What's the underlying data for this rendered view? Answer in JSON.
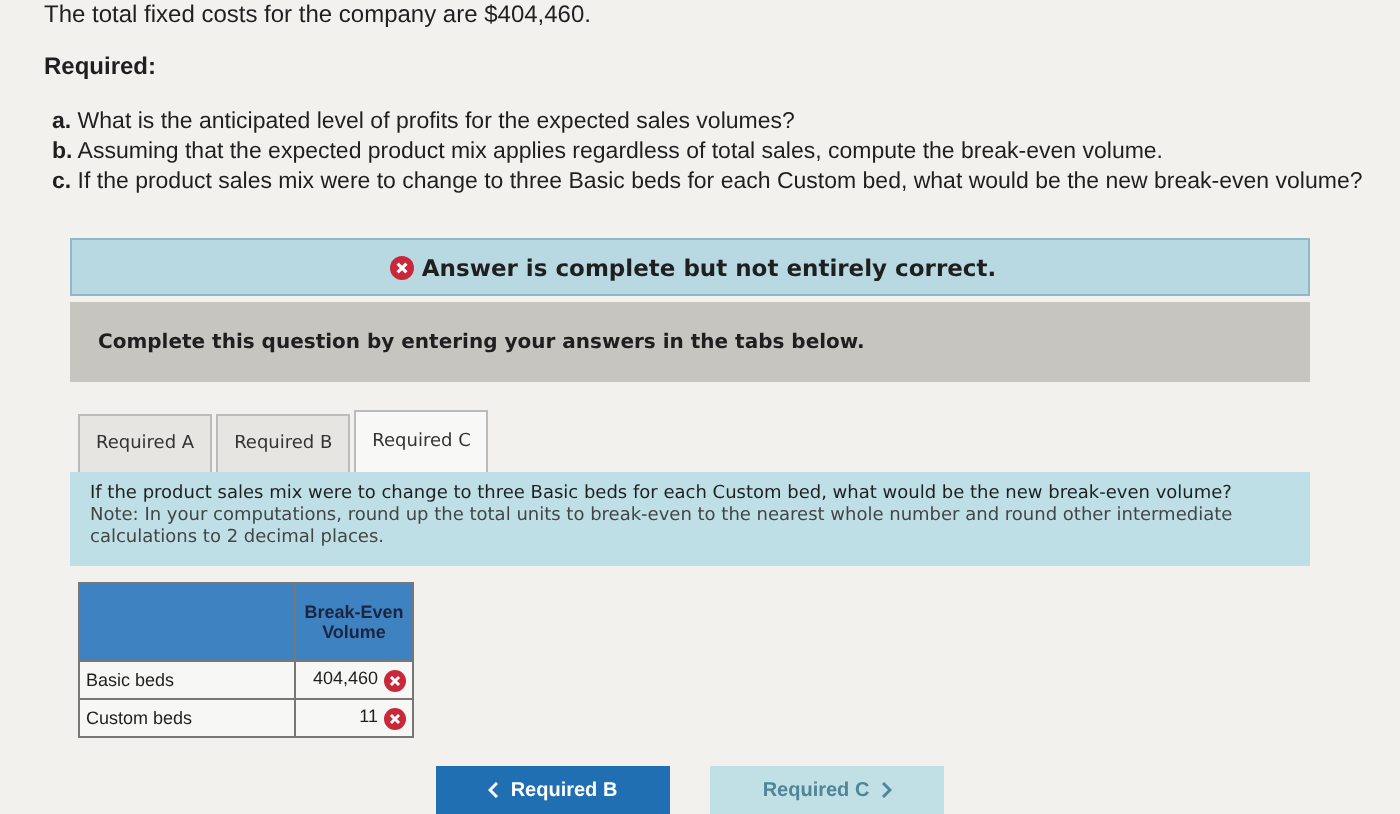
{
  "intro": "The total fixed costs for the company are $404,460.",
  "required": {
    "heading": "Required:",
    "items": [
      {
        "letter": "a.",
        "text": "What is the anticipated level of profits for the expected sales volumes?"
      },
      {
        "letter": "b.",
        "text": "Assuming that the expected product mix applies regardless of total sales, compute the break-even volume."
      },
      {
        "letter": "c.",
        "text": "If the product sales mix were to change to three Basic beds for each Custom bed, what would be the new break-even volume?"
      }
    ]
  },
  "banner": {
    "text": "Answer is complete but not entirely correct.",
    "correct": false
  },
  "instruction": "Complete this question by entering your answers in the tabs below.",
  "tabs": [
    {
      "label": "Required A",
      "selected": false
    },
    {
      "label": "Required B",
      "selected": false
    },
    {
      "label": "Required C",
      "selected": true
    }
  ],
  "question": {
    "text": "If the product sales mix were to change to three Basic beds for each Custom bed, what would be the new break-even volume?",
    "note": "Note: In your computations, round up the total units to break-even to the nearest whole number and round other intermediate calculations to 2 decimal places."
  },
  "table": {
    "columns": [
      "Break-Even Volume"
    ],
    "rows": [
      {
        "label": "Basic beds",
        "value": "404,460",
        "correct": false
      },
      {
        "label": "Custom beds",
        "value": "11",
        "correct": false
      }
    ]
  },
  "buttons": [
    {
      "label": "Required B",
      "kind": "back",
      "disabled": false
    },
    {
      "label": "Required C",
      "kind": "forward",
      "disabled": true
    }
  ]
}
